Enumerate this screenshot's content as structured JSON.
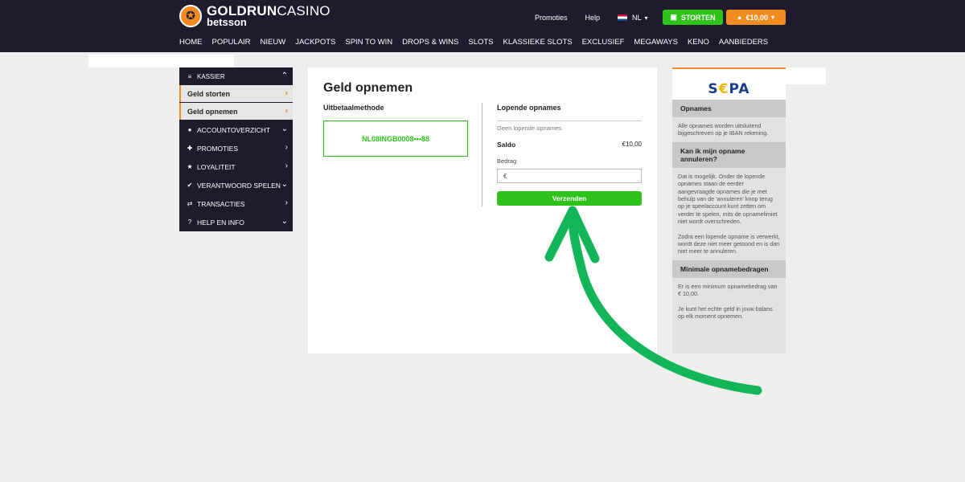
{
  "header": {
    "logo_main_bold": "GOLDRUN",
    "logo_main_thin": "CASINO",
    "logo_sub": "betsson",
    "links": {
      "promoties": "Promoties",
      "help": "Help"
    },
    "language": "NL",
    "storten_label": "STORTEN",
    "balance_label": "€10,00",
    "nav": [
      "HOME",
      "POPULAIR",
      "NIEUW",
      "JACKPOTS",
      "SPIN TO WIN",
      "DROPS & WINS",
      "SLOTS",
      "KLASSIEKE SLOTS",
      "EXCLUSIEF",
      "MEGAWAYS",
      "KENO",
      "AANBIEDERS"
    ]
  },
  "sidebar": {
    "section": "KASSIER",
    "subitems": [
      "Geld storten",
      "Geld opnemen"
    ],
    "items": [
      "ACCOUNTOVERZICHT",
      "PROMOTIES",
      "LOYALITEIT",
      "VERANTWOORD SPELEN",
      "TRANSACTIES",
      "HELP EN INFO"
    ]
  },
  "main": {
    "title": "Geld opnemen",
    "method_label": "Uitbetaalmethode",
    "method_value": "NL08INGB0008•••88",
    "pending_title": "Lopende opnames",
    "pending_empty": "Geen lopende opnames.",
    "saldo_label": "Saldo",
    "saldo_value": "€10,00",
    "bedrag_label": "Bedrag",
    "bedrag_placeholder": "€",
    "submit_label": "Verzenden"
  },
  "info": {
    "logo": "SEPA",
    "sections": [
      {
        "title": "Opnames",
        "paragraphs": [
          "Alle opnames worden uitsluitend bijgeschreven op je IBAN rekening."
        ]
      },
      {
        "title": "Kan ik mijn opname annuleren?",
        "paragraphs": [
          "Dat is mogelijk. Onder de lopende opnames staan de eerder aangevraagde opnames die je met behulp van de 'annuleren' knop terug op je speelaccount kunt zetten om verder te spelen, mits de opnamelimiet niet wordt overschreden.",
          "Zodra een lopende opname is verwerkt, wordt deze niet meer getoond en is dan niet meer te annuleren."
        ]
      },
      {
        "title": "Minimale opnamebedragen",
        "paragraphs": [
          "Er is een minimum opnamebedrag van € 10,00.",
          "Je kunt het echte geld in jouw balans op elk moment opnemen."
        ]
      }
    ]
  },
  "colors": {
    "header_bg": "#1f1a2e",
    "accent_green": "#2ec21a",
    "accent_orange": "#f28c1f",
    "annotation_arrow": "#12b558"
  }
}
